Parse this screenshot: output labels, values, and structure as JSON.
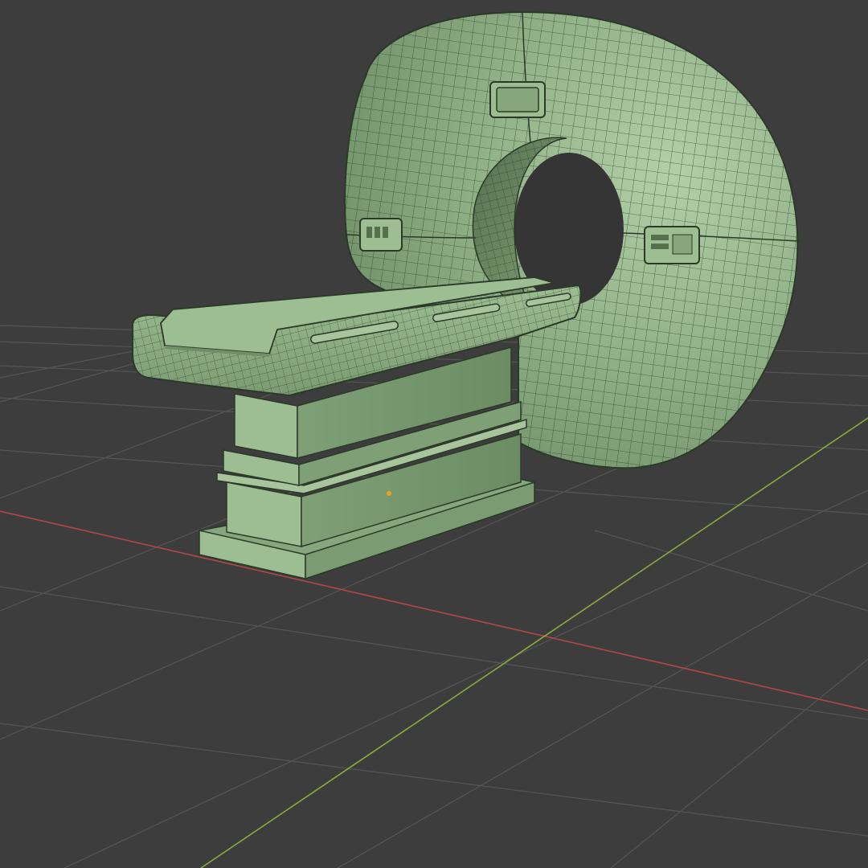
{
  "viewport": {
    "background_color": "#3d3d3d",
    "grid_color": "#555555",
    "x_axis_color": "#b04848",
    "y_axis_color": "#8aab3a",
    "origin_dot_color": "#f0a020"
  },
  "model": {
    "shading": "solid-wireframe",
    "base_color": "#8fb086",
    "shade_color": "#6f8f68",
    "highlight_color": "#b3cfa9",
    "dark_color": "#56704f",
    "wire_color": "#2b3a28",
    "parts": [
      "gantry",
      "gantry-bore",
      "gantry-display-top",
      "gantry-panel-left",
      "gantry-panel-right",
      "patient-table",
      "table-pedestal",
      "table-base"
    ]
  }
}
